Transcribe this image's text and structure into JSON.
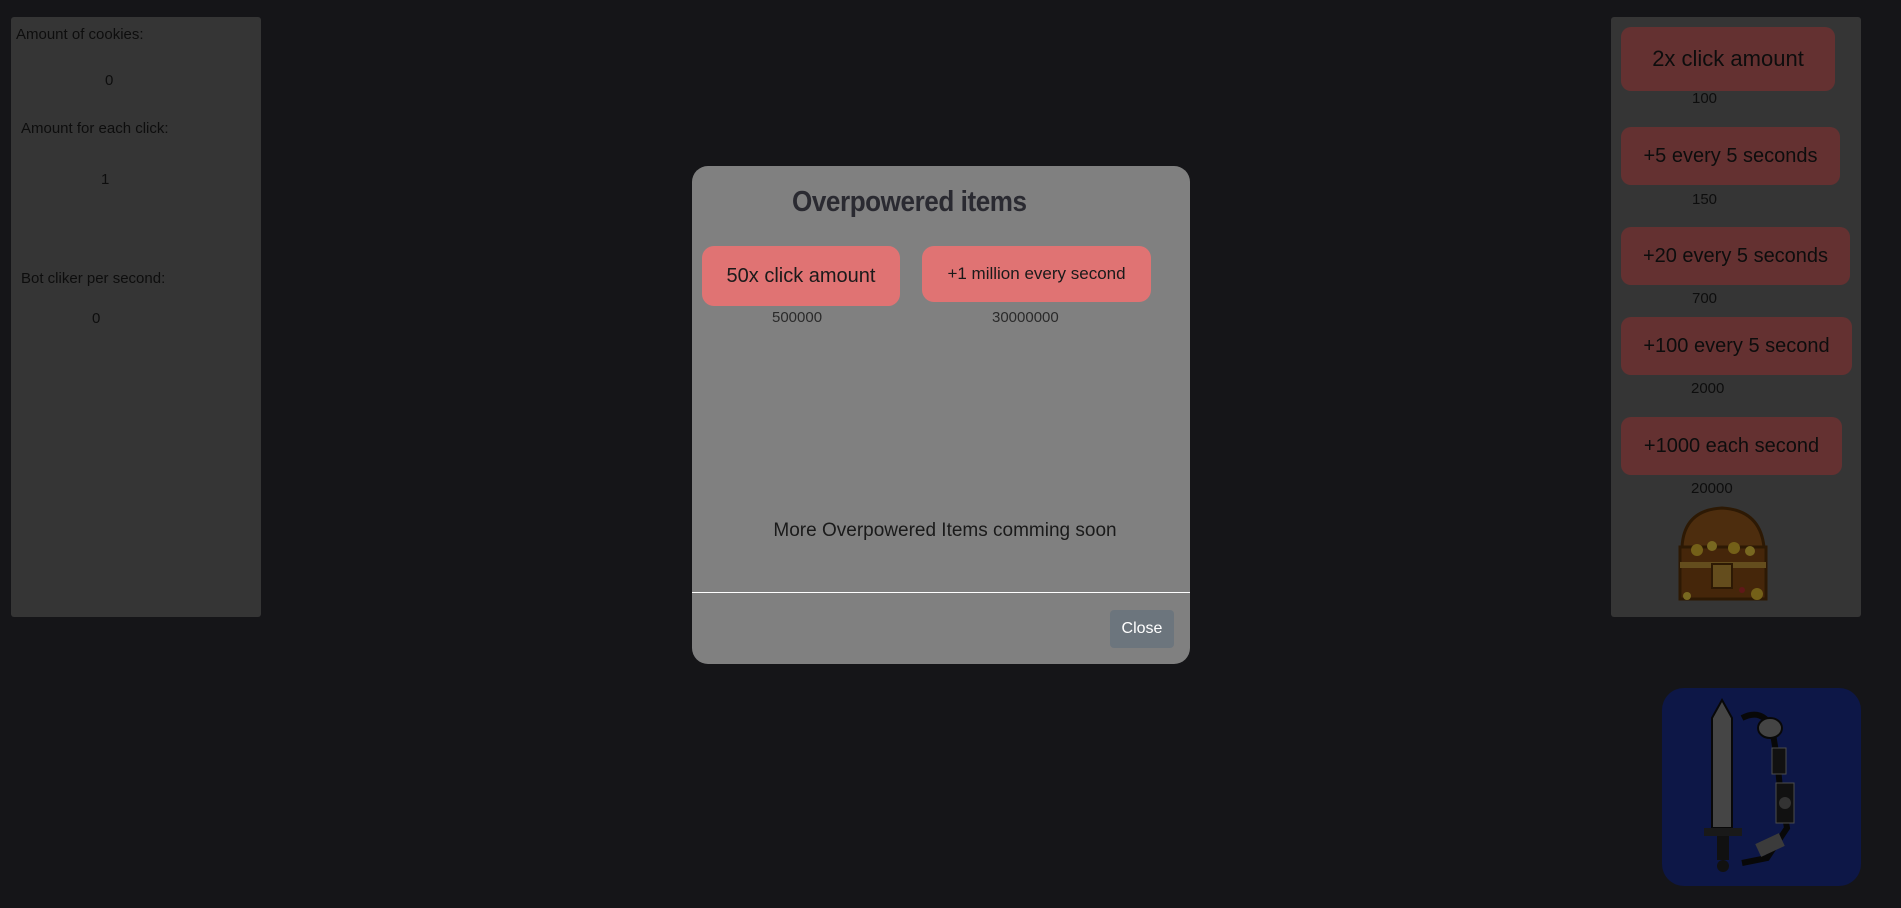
{
  "stats": {
    "cookies_label": "Amount of cookies:",
    "cookies_value": "0",
    "per_click_label": "Amount for each click:",
    "per_click_value": "1",
    "bot_label": "Bot cliker per second:",
    "bot_value": "0"
  },
  "shop": {
    "items": [
      {
        "label": "2x click amount",
        "price": "100"
      },
      {
        "label": "+5 every 5 seconds",
        "price": "150"
      },
      {
        "label": "+20 every 5 seconds",
        "price": "700"
      },
      {
        "label": "+100 every 5 second",
        "price": "2000"
      },
      {
        "label": "+1000 each second",
        "price": "20000"
      }
    ],
    "chest_icon": "treasure-chest-icon"
  },
  "logo": {
    "icon": "sword-logo-icon",
    "background": "#1a2e8f"
  },
  "modal": {
    "title": "Overpowered items",
    "items": [
      {
        "label": "50x click amount",
        "price": "500000"
      },
      {
        "label": "+1 million every second",
        "price": "30000000"
      }
    ],
    "coming_soon": "More Overpowered Items comming soon",
    "close_label": "Close"
  },
  "colors": {
    "background": "#2a2a31",
    "button": "#e07373",
    "modal": "#808080",
    "close": "#6c757d"
  }
}
